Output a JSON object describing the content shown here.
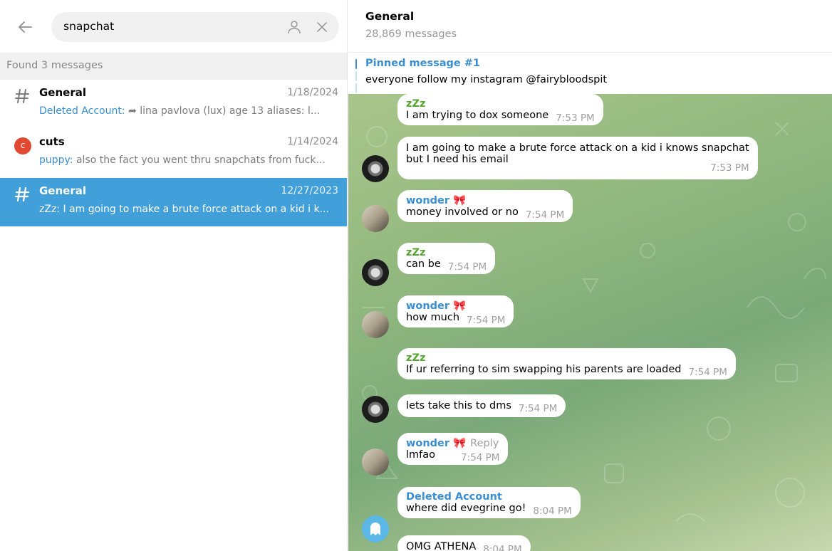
{
  "search": {
    "query": "snapchat"
  },
  "results": {
    "found_label": "Found 3 messages",
    "items": [
      {
        "title": "General",
        "date": "1/18/2024",
        "sender": "Deleted Account:",
        "preview": " lina pavlova (lux) age 13 aliases:  l...",
        "icon": "hash-icon"
      },
      {
        "title": "cuts",
        "date": "1/14/2024",
        "sender": "puppy:",
        "preview": " also the fact you went thru snapchats from fuck...",
        "icon": "red-group-avatar",
        "icon_letter": "c"
      },
      {
        "title": "General",
        "date": "12/27/2023",
        "sender": "zZz:",
        "preview": " I am going to make a brute force attack on a kid i k...",
        "icon": "hash-icon"
      }
    ]
  },
  "chat": {
    "title": "General",
    "count": "28,869 messages",
    "pinned_title": "Pinned message #1",
    "pinned_text": "everyone follow my instagram @fairybloodspit",
    "messages": [
      {
        "name": "zZz",
        "text": "I am trying to dox someone",
        "time": "7:53 PM"
      },
      {
        "text": "I am going to make a brute force attack on a kid i knows snapchat",
        "text2": "but I need his email",
        "time": "7:53 PM"
      },
      {
        "name": "wonder",
        "text": "money involved or no",
        "time": "7:54 PM"
      },
      {
        "name": "zZz",
        "text": "can be",
        "time": "7:54 PM"
      },
      {
        "name": "wonder",
        "text": "how much",
        "time": "7:54 PM"
      },
      {
        "name": "zZz",
        "text": "If ur referring to sim swapping his parents are loaded",
        "time": "7:54 PM"
      },
      {
        "text": "lets take this to dms",
        "time": "7:54 PM"
      },
      {
        "name": "wonder",
        "reply": "Reply",
        "text": "lmfao",
        "time": "7:54 PM"
      },
      {
        "name": "Deleted Account",
        "text": "where did evegrine go!",
        "time": "8:04 PM"
      },
      {
        "text": "OMG ATHENA",
        "time": "8:04 PM"
      }
    ]
  },
  "colors": {
    "accent": "#419fd9",
    "link": "#3a8ed1",
    "green_name": "#56a630",
    "chat_bg": "#8fb77e"
  }
}
